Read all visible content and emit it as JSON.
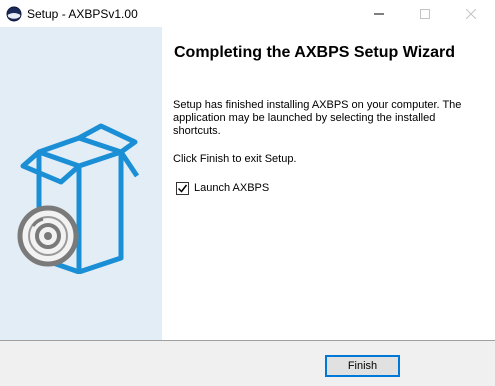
{
  "window": {
    "title": "Setup - AXBPSv1.00",
    "app_icon": "setup-globe-icon",
    "controls": [
      "minimize-icon",
      "maximize-icon",
      "close-icon"
    ]
  },
  "sidebar": {
    "art": "box-and-disc-icon",
    "background_color": "#e3edf6",
    "accent_color": "#1b8fd6"
  },
  "main": {
    "heading": "Completing the AXBPS Setup Wizard",
    "description": "Setup has finished installing AXBPS on your computer. The application may be launched by selecting the installed shortcuts.",
    "exit_instruction": "Click Finish to exit Setup.",
    "launch_checkbox": {
      "label": "Launch AXBPS",
      "checked": true
    }
  },
  "footer": {
    "finish_label": "Finish",
    "focus_color": "#0078d7"
  }
}
